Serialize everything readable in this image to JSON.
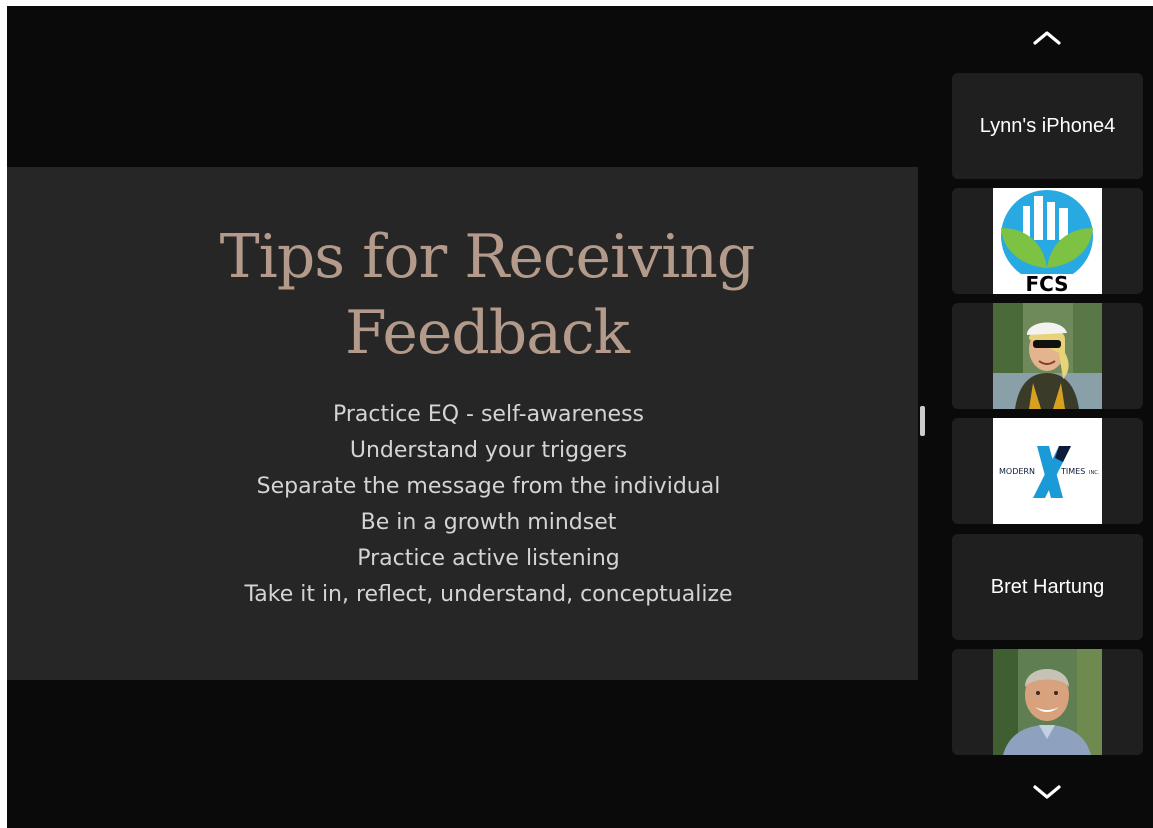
{
  "slide": {
    "title_line1": "Tips for Receiving",
    "title_line2": "Feedback",
    "bullets": [
      "Practice EQ - self-awareness",
      "Understand your triggers",
      "Separate the message from the individual",
      "Be in a growth mindset",
      "Practice active listening",
      "Take it in, reflect, understand, conceptualize"
    ]
  },
  "participants": {
    "tile1_name": "Lynn's iPhone4",
    "tile2_logo_text": "FCS",
    "tile4_logo_text_left": "MODERN",
    "tile4_logo_text_right": "TIMES",
    "tile4_logo_suffix": "INC.",
    "tile5_name": "Bret Hartung"
  },
  "icons": {
    "scroll_up": "chevron-up-icon",
    "scroll_down": "chevron-down-icon"
  },
  "colors": {
    "title": "#b39a8a",
    "stage_bg": "#262626",
    "window_bg": "#0a0a0a",
    "tile_bg": "#1f1f1f",
    "fcs_sky": "#29a9e1",
    "fcs_leaf": "#7dc242",
    "modern_times_x": "#1a9ad6"
  }
}
